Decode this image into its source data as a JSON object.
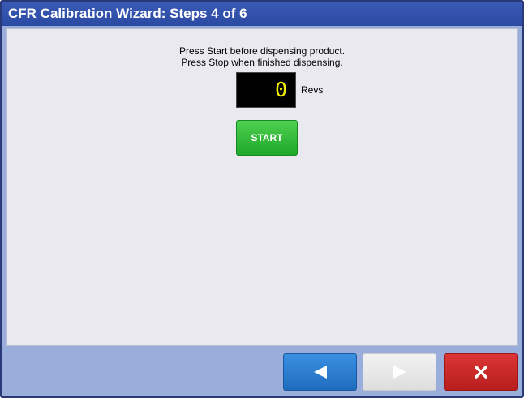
{
  "window": {
    "title": "CFR Calibration Wizard: Steps 4 of 6"
  },
  "instructions": {
    "line1": "Press Start before dispensing product.",
    "line2": "Press Stop when finished dispensing."
  },
  "counter": {
    "value": "0",
    "unit": "Revs"
  },
  "start_button": {
    "label": "START"
  },
  "nav": {
    "back_icon": "left-arrow-icon",
    "next_icon": "right-arrow-icon",
    "cancel_icon": "close-x-icon",
    "next_enabled": false
  },
  "colors": {
    "title_bar": "#2b4aa2",
    "start_green": "#2bb535",
    "back_blue": "#2c7fd6",
    "cancel_red": "#cc2a2a",
    "counter_digits": "#f2f000"
  }
}
